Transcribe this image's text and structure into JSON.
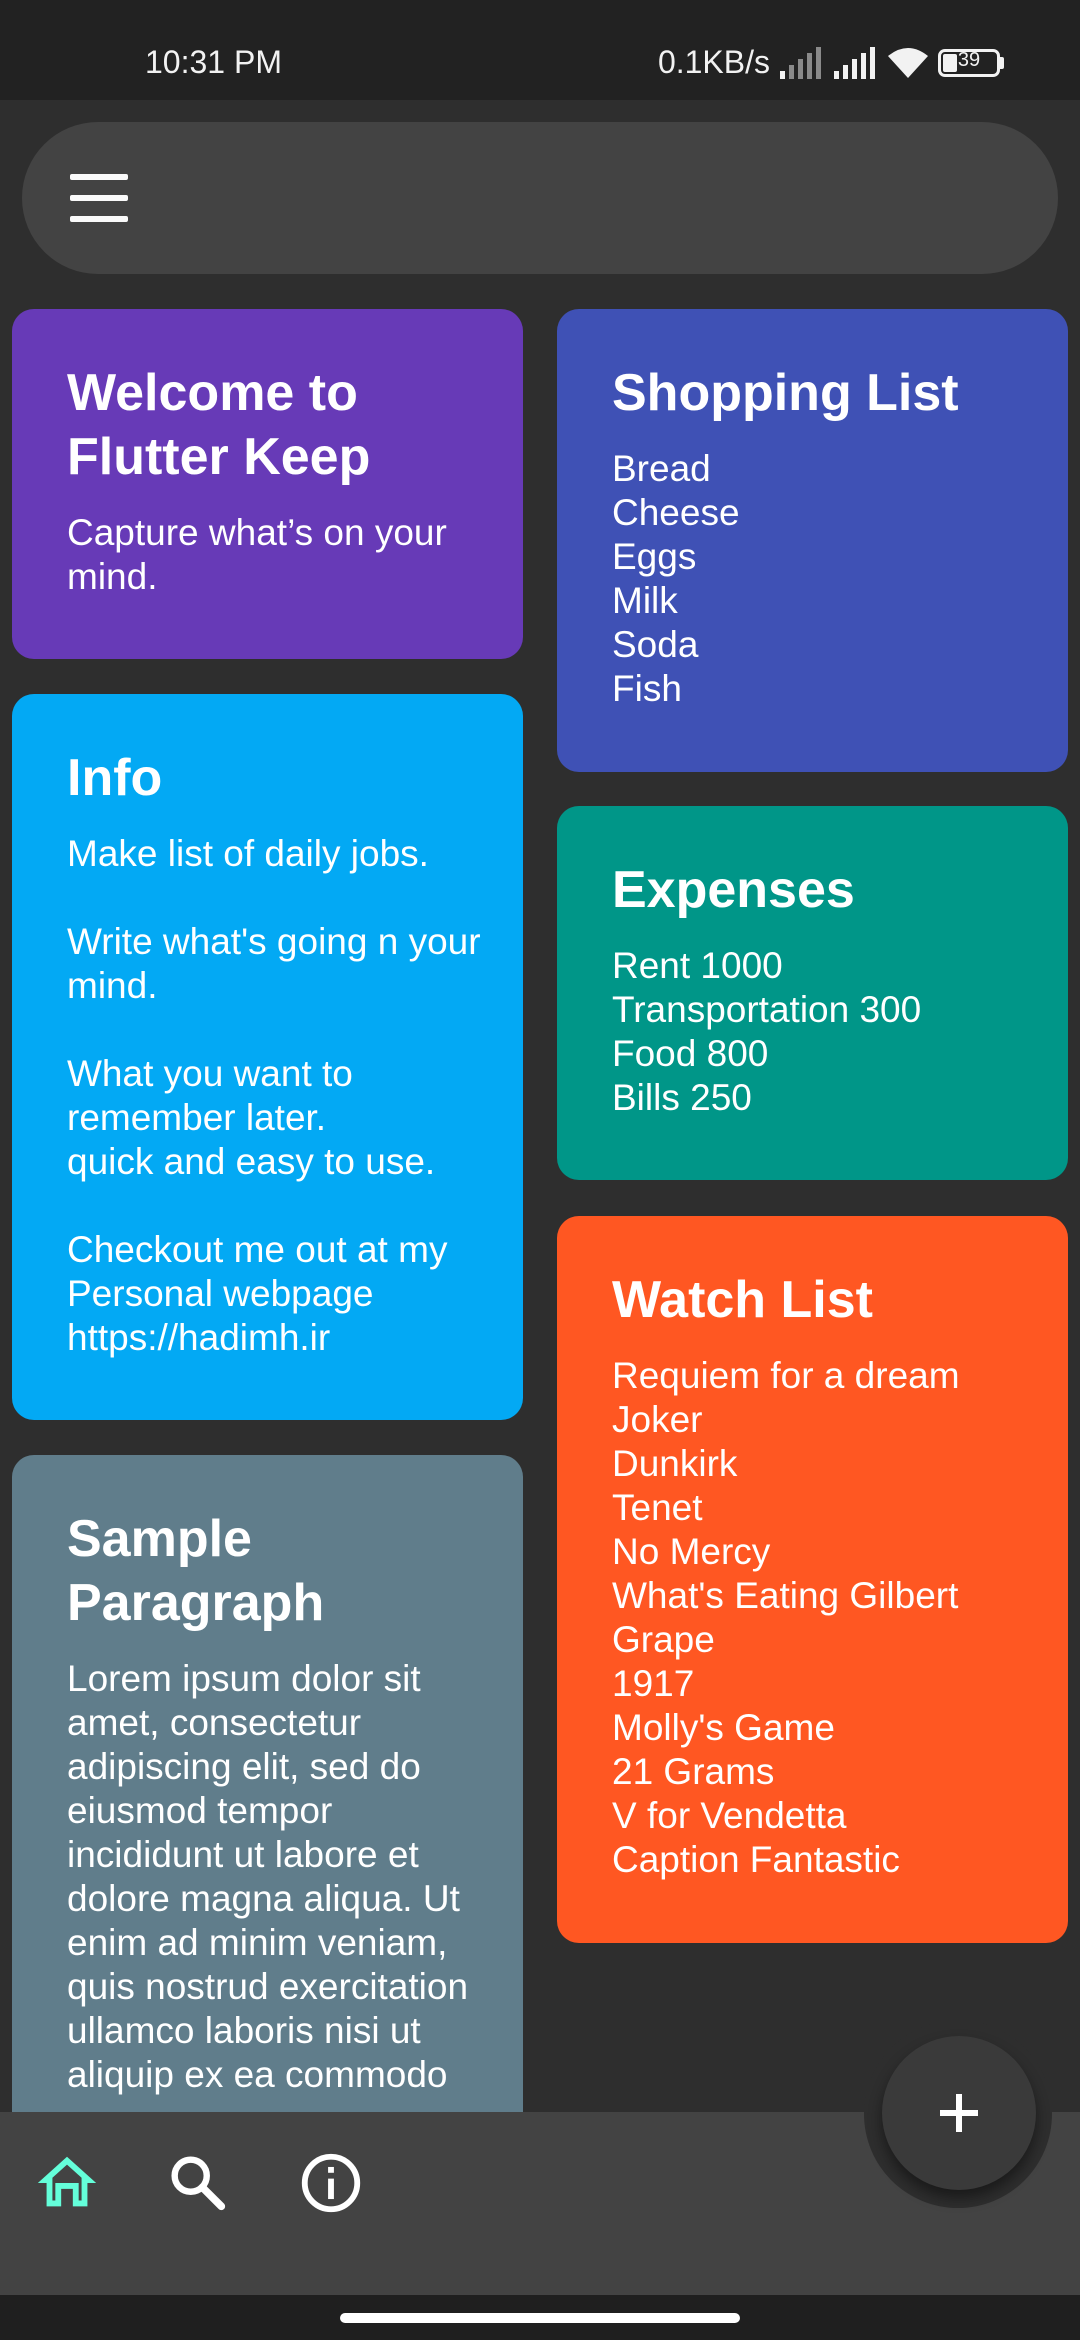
{
  "status_bar": {
    "time": "10:31 PM",
    "network_speed": "0.1KB/s",
    "battery": "39",
    "icons": [
      "signal-weak-icon",
      "signal-strong-icon",
      "wifi-icon",
      "battery-icon"
    ]
  },
  "search_bar": {
    "menu_icon": "menu-icon"
  },
  "notes": {
    "welcome": {
      "title": "Welcome to Flutter Keep",
      "body": "Capture what’s on your mind.",
      "color": "#673ab7"
    },
    "info": {
      "title": "Info",
      "body": "Make list of daily jobs.\n\nWrite what's going n your mind.\n\nWhat you want to remember later.\nquick and easy to use.\n\nCheckout me out at my Personal webpage\nhttps://hadimh.ir",
      "color": "#03a9f4"
    },
    "sample": {
      "title": "Sample Paragraph",
      "body": "Lorem ipsum dolor sit amet, consectetur adipiscing elit, sed do eiusmod tempor incididunt ut labore et dolore magna aliqua. Ut enim ad minim veniam, quis nostrud exercitation ullamco laboris nisi ut aliquip ex ea commodo",
      "color": "#607d8b"
    },
    "shopping": {
      "title": "Shopping List",
      "body": "Bread\nCheese\nEggs\nMilk\nSoda\nFish",
      "color": "#3f51b5"
    },
    "expenses": {
      "title": "Expenses",
      "body": "Rent 1000\nTransportation 300\nFood 800\nBills 250",
      "color": "#009688"
    },
    "watch": {
      "title": "Watch List",
      "body": "Requiem for a dream\nJoker\nDunkirk\nTenet\nNo Mercy\nWhat's Eating Gilbert Grape\n1917\nMolly's Game\n21 Grams\nV for Vendetta\nCaption Fantastic",
      "color": "#ff5722"
    }
  },
  "bottom_nav": {
    "items": [
      {
        "icon": "home-icon",
        "active": true,
        "color": "#64ffda"
      },
      {
        "icon": "search-icon",
        "active": false
      },
      {
        "icon": "info-icon",
        "active": false
      }
    ],
    "fab_icon": "plus-icon"
  }
}
